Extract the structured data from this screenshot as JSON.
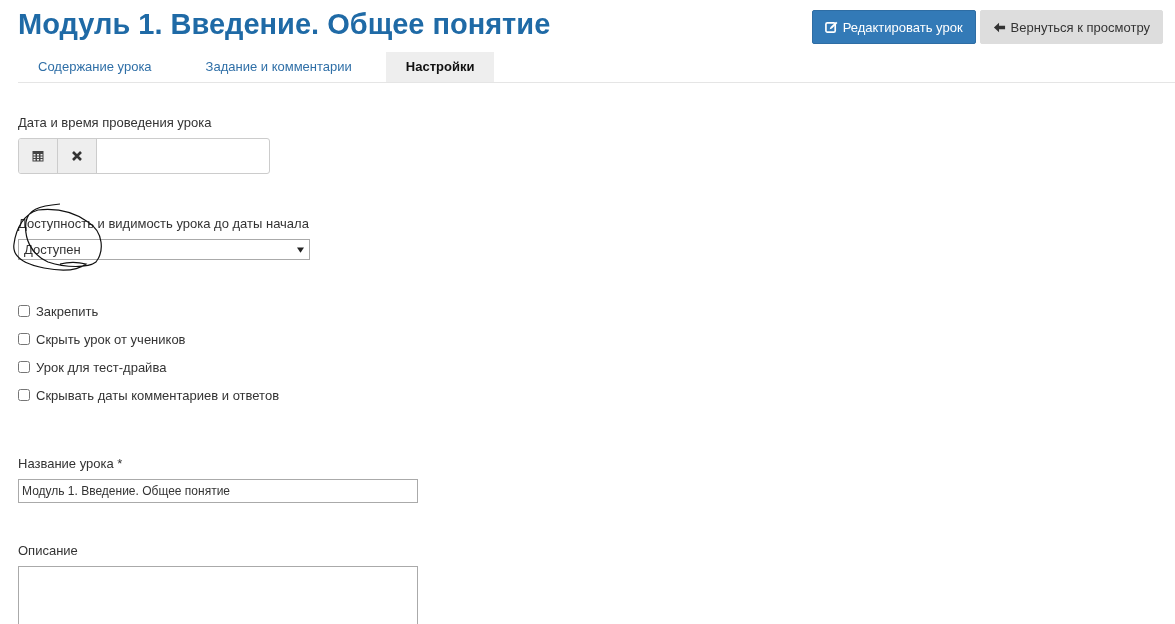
{
  "title": "Модуль 1. Введение. Общее понятие",
  "actions": [
    {
      "label": "Редактировать урок",
      "kind": "primary"
    },
    {
      "label": "Вернуться к просмотру",
      "kind": "secondary"
    }
  ],
  "tabs": [
    {
      "label": "Содержание урока",
      "selected": false
    },
    {
      "label": "Задание и комментарии",
      "selected": false
    },
    {
      "label": "Настройки",
      "selected": true
    }
  ],
  "date": {
    "label": "Дата и время проведения урока"
  },
  "availability": {
    "label": "Доступность и видимость урока до даты начала",
    "value": "Доступен",
    "annotated": true
  },
  "options": [
    {
      "label": "Закрепить",
      "checked": false
    },
    {
      "label": "Скрыть урок от учеников",
      "checked": false
    },
    {
      "label": "Урок для тест-драйва",
      "checked": false
    },
    {
      "label": "Скрывать даты комментариев и ответов",
      "checked": false
    }
  ],
  "name": {
    "label": "Название урока *",
    "value": "Модуль 1. Введение. Общее понятие"
  },
  "description": {
    "label": "Описание"
  }
}
